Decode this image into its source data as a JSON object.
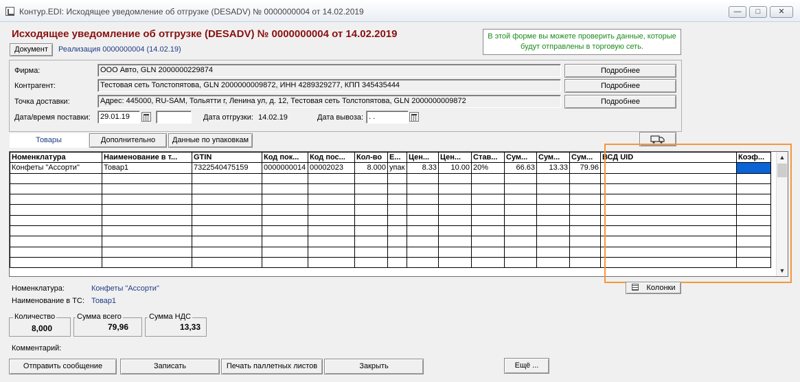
{
  "window": {
    "title": "Контур.EDI: Исходящее уведомление об отгрузке (DESADV) № 0000000004 от 14.02.2019",
    "controls": [
      "—",
      "□",
      "✕"
    ]
  },
  "header": {
    "doc_title": "Исходящее уведомление об отгрузке (DESADV) № 0000000004 от 14.02.2019",
    "document_button": "Документ",
    "realization_link": "Реализация  0000000004 (14.02.19)",
    "hint": "В этой форме вы можете проверить данные, которые будут отправлены в торговую сеть."
  },
  "details": {
    "firm_label": "Фирма:",
    "firm_value": "ООО Авто, GLN 2000000229874",
    "contractor_label": "Контрагент:",
    "contractor_value": "Тестовая сеть Толстопятова, GLN 2000000009872, ИНН 4289329277, КПП 345435444",
    "delivery_label": "Точка доставки:",
    "delivery_value": "Адрес: 445000, RU-SAM, Тольятти г, Ленина ул, д. 12, Тестовая сеть Толстопятова, GLN 2000000009872",
    "more_button": "Подробнее",
    "delivery_date_label": "Дата/время поставки:",
    "delivery_date_value": "29.01.19",
    "delivery_time_value": "",
    "ship_date_label": "Дата отгрузки:",
    "ship_date_value": "14.02.19",
    "pickup_date_label": "Дата вывоза:",
    "pickup_date_value": " .  ."
  },
  "tabs": [
    {
      "label": "Товары",
      "active": true
    },
    {
      "label": "Дополнительно",
      "active": false
    },
    {
      "label": "Данные по упаковкам",
      "active": false
    }
  ],
  "grid": {
    "columns": [
      "Номенклатура",
      "Наименование в т...",
      "GTIN",
      "Код пок...",
      "Код пос...",
      "Кол-во",
      "Е...",
      "Цен...",
      "Цен...",
      "Став...",
      "Сум...",
      "Сум...",
      "Сум...",
      "ВСД UID",
      "Коэф..."
    ],
    "rows": [
      [
        "Конфеты \"Ассорти\"",
        "Товар1",
        "7322540475159",
        "0000000014",
        "00002023",
        "8.000",
        "упак",
        "8.33",
        "10.00",
        "20%",
        "66.63",
        "13.33",
        "79.96",
        "",
        ""
      ]
    ],
    "empty_rows": 9
  },
  "footer": {
    "nomenclature_label": "Номенклатура:",
    "nomenclature_value": "Конфеты \"Ассорти\"",
    "name_in_ts_label": "Наименование в ТС:",
    "name_in_ts_value": "Товар1",
    "columns_button": "Колонки",
    "quantity_label": "Количество",
    "quantity_value": "8,000",
    "total_label": "Сумма всего",
    "total_value": "79,96",
    "vat_label": "Сумма НДС",
    "vat_value": "13,33",
    "comment_label": "Комментарий:"
  },
  "actions": {
    "send": "Отправить сообщение",
    "save": "Записать",
    "print": "Печать паллетных листов",
    "close": "Закрыть",
    "more": "Ещё ..."
  },
  "colors": {
    "title_red": "#8a1010",
    "hint_green": "#1b8a1b",
    "link_blue": "#1f3b86",
    "highlight_orange": "#f5963a",
    "selection_blue": "#0a64d6"
  }
}
